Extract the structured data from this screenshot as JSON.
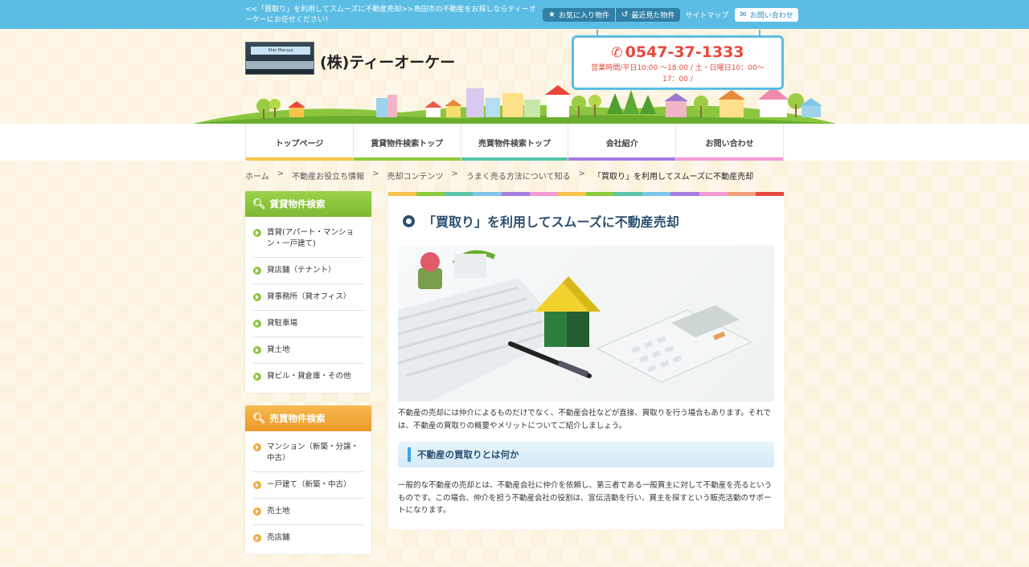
{
  "topbar": {
    "description": "<<「買取り」を利用してスムーズに不動産売却>>島田市の不動産をお探しならティーオーケーにお任せください！",
    "favorites": "お気に入り物件",
    "recent": "最近見た物件",
    "sitemap": "サイトマップ",
    "contact": "お問い合わせ"
  },
  "header": {
    "company": "(株)ティーオーケー",
    "phone": "0547-37-1333",
    "hours": "営業時間/平日10:00 ～18:00 / 土・日曜日10：00～17：00 /"
  },
  "nav": {
    "items": [
      {
        "label": "トップページ",
        "color": "#f6c34a"
      },
      {
        "label": "賃貸物件検索トップ",
        "color": "#8ccb3c"
      },
      {
        "label": "売買物件検索トップ",
        "color": "#59c3a6"
      },
      {
        "label": "会社紹介",
        "color": "#a57be0"
      },
      {
        "label": "お問い合わせ",
        "color": "#f29ad6"
      }
    ]
  },
  "breadcrumb": {
    "items": [
      "ホーム",
      "不動産お役立ち情報",
      "売却コンテンツ",
      "うまく売る方法について知る",
      "「買取り」を利用してスムーズに不動産売却"
    ],
    "separator": ">"
  },
  "sidebar": {
    "rent": {
      "title": "賃貸物件検索",
      "color": "#8cc63f",
      "items": [
        "賃貸(アパート・マンション・一戸建て)",
        "貸店舗（テナント）",
        "貸事務所（貸オフィス）",
        "貸駐車場",
        "貸土地",
        "貸ビル・貸倉庫・その他"
      ]
    },
    "sale": {
      "title": "売買物件検索",
      "color": "#f2a93b",
      "items": [
        "マンション（新築・分譲・中古）",
        "一戸建て（新築・中古）",
        "売土地",
        "売店舗"
      ]
    }
  },
  "main": {
    "title": "「買取り」を利用してスムーズに不動産売却",
    "lead": "不動産の売却には仲介によるものだけでなく、不動産会社などが直接、買取りを行う場合もあります。それでは、不動産の買取りの概要やメリットについてご紹介しましょう。",
    "section_title": "不動産の買取りとは何か",
    "section_body": "一般的な不動産の売却とは、不動産会社に仲介を依頼し、第三者である一般買主に対して不動産を売るというものです。この場合、仲介を担う不動産会社の役割は、宣伝活動を行い、買主を探すという販売活動のサポートになります。"
  },
  "icons": [
    "star-icon",
    "history-icon",
    "mail-icon",
    "phone-icon",
    "search-icon",
    "chevron-right-icon"
  ]
}
